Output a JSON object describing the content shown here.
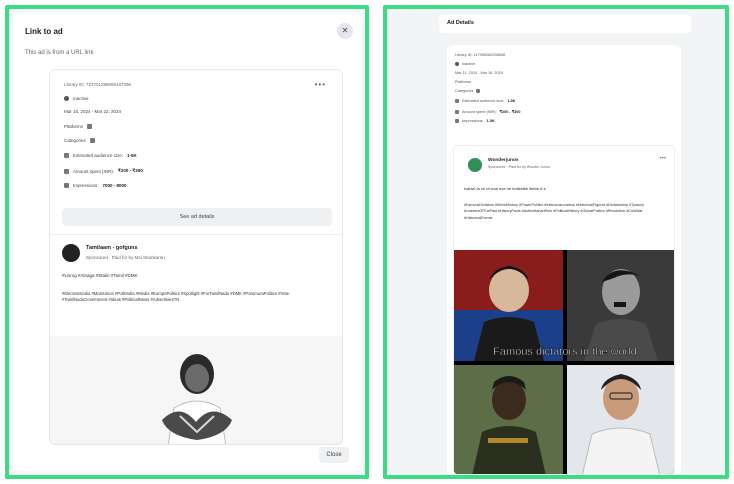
{
  "left": {
    "modal_title": "Link to ad",
    "subtitle": "This ad is from a URL link",
    "close_icon": "close-icon",
    "card": {
      "library_id": "Library ID: 721701298086187296",
      "status": "Inactive",
      "dates": "Mar 15, 2024 - Mar 22, 2024",
      "platforms_label": "Platforms",
      "categories_label": "Categories",
      "audience_label": "Estimated audience size:",
      "audience_value": "1-5K",
      "spend_label": "Amount spent (INR):",
      "spend_value": "₹200 - ₹300",
      "impressions_label": "Impressions:",
      "impressions_value": "7000 - 8000",
      "see_details": "See ad details",
      "page_name": "Tamilaam - gofguns",
      "page_sub": "Sponsored · Paid for by Mai Shankaran",
      "ad_text": "#Lisrog #Alnaga #Stalin #Tamil #DMK",
      "ad_tags": "#ElectionsIndia #MainUnion #PolitIndia #Media #EuropePolitics #Spotlight #ForTamilNadu #DMK #PorumuraPolitics #Vote #TamilNaduGovernment #Ideas #PoliticalNews #AdvertisersTN"
    },
    "close_button": "Close"
  },
  "right": {
    "header": "Ad Details",
    "rows": {
      "library": "Library ID: 117955282038808",
      "status": "Inactive",
      "dates": "Mar 11, 2024 - Mar 18, 2024",
      "platforms": "Platforms",
      "categories": "Categories",
      "audience": "Estimated audience size:",
      "audience_value": "1-5K",
      "spend": "Amount spent (INR):",
      "spend_value": "₹200 - ₹300",
      "impressions": "Impressions:",
      "impressions_value": "1-5K"
    },
    "post": {
      "name": "Wonderjunos",
      "sub": "Sponsored · Paid for by Wonder Junos",
      "text": "Ivanvil Ia vu of worl eve ne indiesthe lifetre 8 s",
      "tags": "#FamousDictators #WorldHistory #PowerPolitics #InfamousLeaders #HistoricalFigures #Dictatorship #Tyranny #LeadersOfThePast #HistoryFacts #AuthoritarianRule #PoliticalHistory #GlobalPolitics #Revolution #ColdWar #HistoricalEvents",
      "caption": "Famous dictators in the world"
    }
  }
}
